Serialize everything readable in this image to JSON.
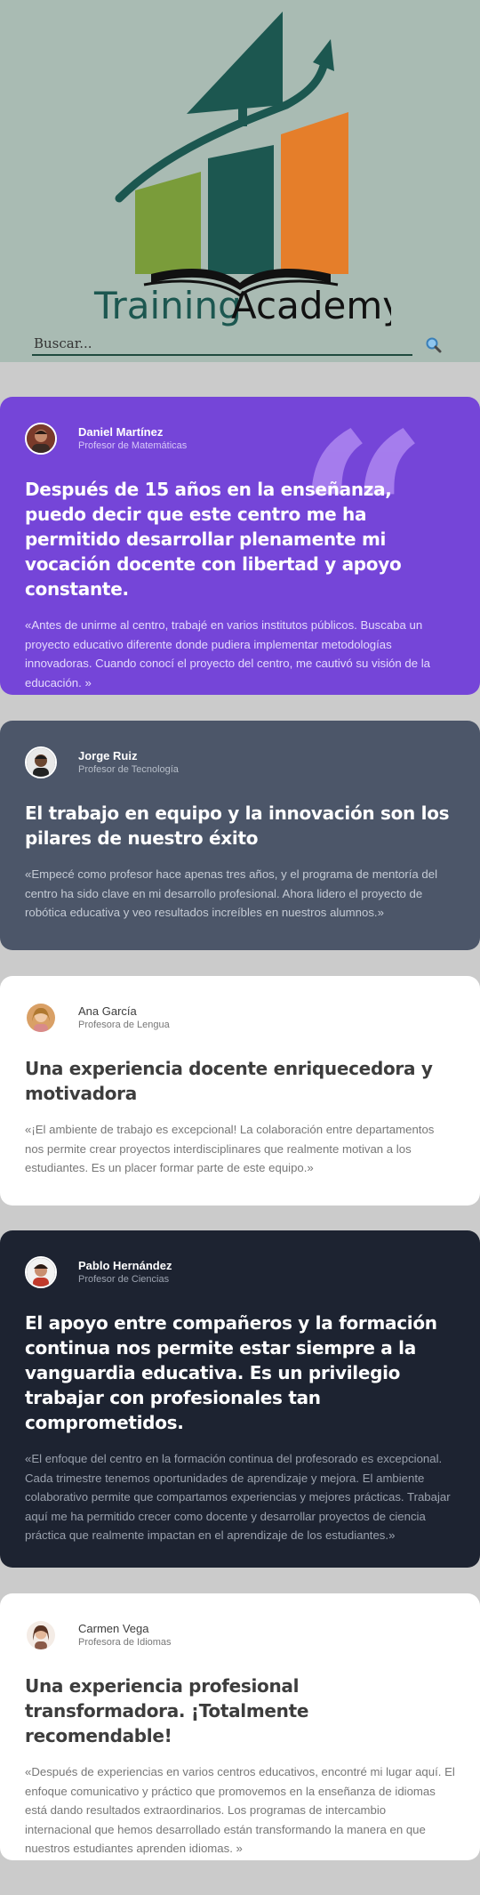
{
  "brand": {
    "logo_word_1": "Training",
    "logo_word_2": "Academy",
    "colors": {
      "dark_teal": "#1c5750",
      "green": "#7a9c3a",
      "orange": "#e57e2a",
      "header_bg": "#a9bbb3"
    }
  },
  "search": {
    "placeholder": "Buscar...",
    "icon": "search-icon"
  },
  "testimonials": [
    {
      "name": "Daniel Martínez",
      "role": "Profesor de Matemáticas",
      "title": "Después de 15 años en la enseñanza, puedo decir que este centro me ha permitido desarrollar plenamente mi vocación docente con libertad y apoyo constante.",
      "quote": "«Antes de unirme al centro, trabajé en varios institutos públicos. Buscaba un proyecto educativo diferente donde pudiera implementar metodologías innovadoras. Cuando conocí el proyecto del centro, me cautivó su visión de la educación. »",
      "quote_mark": "“",
      "bg": "#7545d8"
    },
    {
      "name": "Jorge Ruiz",
      "role": "Profesor de Tecnología",
      "title": "El trabajo en equipo y la innovación son los pilares de nuestro éxito",
      "quote": "«Empecé como profesor hace apenas tres años, y el programa de mentoría del centro ha sido clave en mi desarrollo profesional. Ahora lidero el proyecto de robótica educativa y veo resultados increíbles en nuestros alumnos.»",
      "bg": "#4c5669"
    },
    {
      "name": "Ana García",
      "role": "Profesora de Lengua",
      "title": "Una experiencia docente enriquecedora y motivadora",
      "quote": "«¡El ambiente de trabajo es excepcional! La colaboración entre departamentos nos permite crear proyectos interdisciplinares que realmente motivan a los estudiantes. Es un placer formar parte de este equipo.»",
      "bg": "#ffffff"
    },
    {
      "name": "Pablo Hernández",
      "role": "Profesor de Ciencias",
      "title": "El apoyo entre compañeros y la formación continua nos permite estar siempre a la vanguardia educativa. Es un privilegio trabajar con profesionales tan comprometidos.",
      "quote": "«El enfoque del centro en la formación continua del profesorado es excepcional. Cada trimestre tenemos oportunidades de aprendizaje y mejora. El ambiente colaborativo permite que compartamos experiencias y mejores prácticas. Trabajar aquí me ha permitido crecer como docente y desarrollar proyectos de ciencia práctica que realmente impactan en el aprendizaje de los estudiantes.»",
      "bg": "#1d2331"
    },
    {
      "name": "Carmen Vega",
      "role": "Profesora de Idiomas",
      "title": "Una experiencia profesional transformadora. ¡Totalmente recomendable!",
      "quote": "«Después de experiencias en varios centros educativos, encontré mi lugar aquí. El enfoque comunicativo y práctico que promovemos en la enseñanza de idiomas está dando resultados extraordinarios. Los programas de intercambio internacional que hemos desarrollado están transformando la manera en que nuestros estudiantes aprenden idiomas. »",
      "bg": "#ffffff"
    }
  ]
}
